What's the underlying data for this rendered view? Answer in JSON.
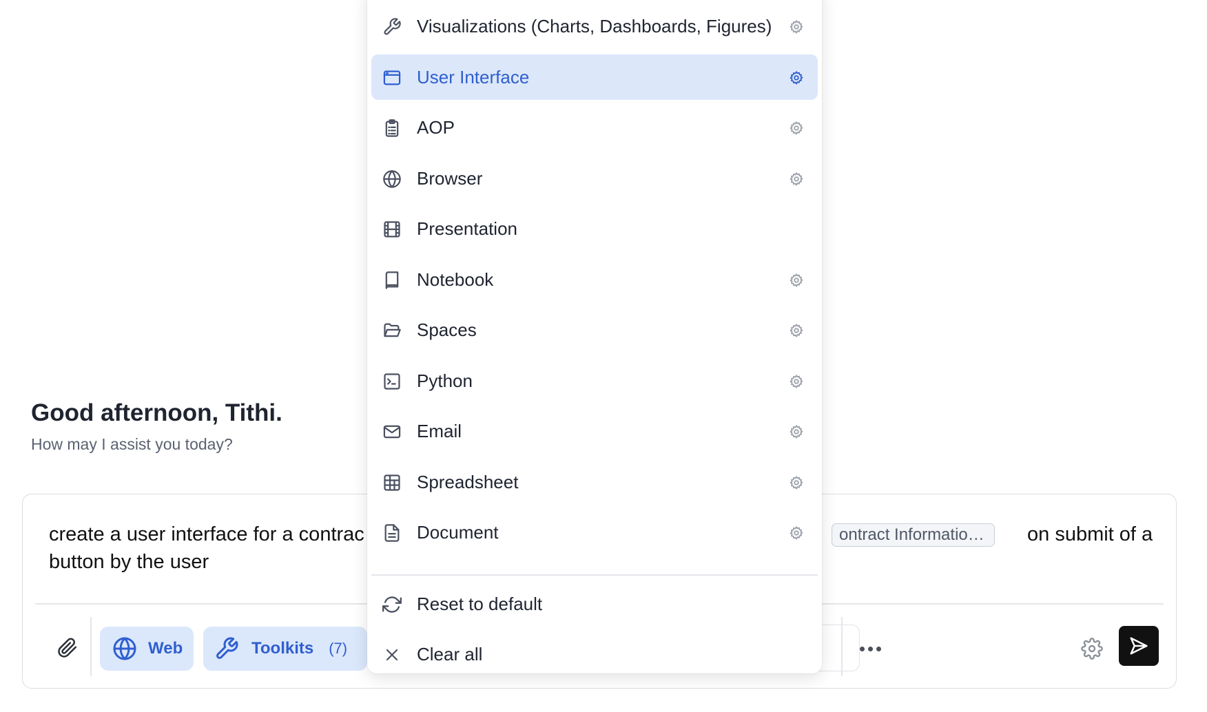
{
  "greeting": {
    "title": "Good afternoon, Tithi.",
    "subtitle": "How may I assist you today?"
  },
  "composer": {
    "line1_before": "create a user interface for a contrac",
    "reference_chip": "ontract Informatio…",
    "line1_after": "on submit of a",
    "line2": "button by the user",
    "web_label": "Web",
    "toolkits_label": "Toolkits",
    "toolkits_count": "(7)"
  },
  "menu": {
    "items": [
      {
        "label": "Visualizations (Charts, Dashboards, Figures)",
        "icon": "wrench-icon",
        "has_settings": true,
        "active": false
      },
      {
        "label": "User Interface",
        "icon": "window-icon",
        "has_settings": true,
        "active": true
      },
      {
        "label": "AOP",
        "icon": "clipboard-list-icon",
        "has_settings": true,
        "active": false
      },
      {
        "label": "Browser",
        "icon": "globe-icon",
        "has_settings": true,
        "active": false
      },
      {
        "label": "Presentation",
        "icon": "film-icon",
        "has_settings": false,
        "active": false
      },
      {
        "label": "Notebook",
        "icon": "book-icon",
        "has_settings": true,
        "active": false
      },
      {
        "label": "Spaces",
        "icon": "folder-open-icon",
        "has_settings": true,
        "active": false
      },
      {
        "label": "Python",
        "icon": "terminal-icon",
        "has_settings": true,
        "active": false
      },
      {
        "label": "Email",
        "icon": "mail-icon",
        "has_settings": true,
        "active": false
      },
      {
        "label": "Spreadsheet",
        "icon": "table-icon",
        "has_settings": true,
        "active": false
      },
      {
        "label": "Document",
        "icon": "document-icon",
        "has_settings": true,
        "active": false
      }
    ],
    "reset_label": "Reset to default",
    "clear_label": "Clear all"
  },
  "colors": {
    "accent": "#2f5fcf",
    "active_bg": "#dce7fa",
    "chip_bg": "#dbe7fb",
    "send_bg": "#111111"
  }
}
